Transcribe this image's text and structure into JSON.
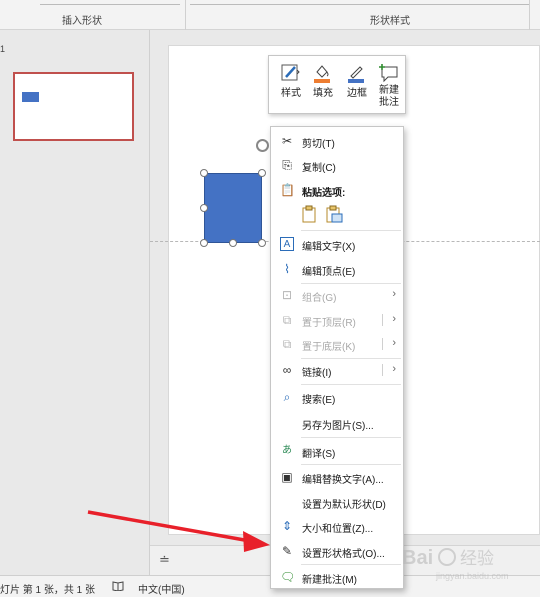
{
  "ribbon": {
    "group_insert_shapes": "插入形状",
    "group_shape_styles": "形状样式"
  },
  "thumbnails": {
    "slide_number": "1"
  },
  "mini_toolbar": {
    "items": [
      {
        "label": "样式",
        "icon": "style-brush-icon"
      },
      {
        "label": "填充",
        "icon": "fill-bucket-icon"
      },
      {
        "label": "边框",
        "icon": "outline-pen-icon"
      },
      {
        "label_line1": "新建",
        "label_line2": "批注",
        "icon": "new-comment-icon"
      }
    ]
  },
  "context_menu": {
    "cut": "剪切(T)",
    "copy": "复制(C)",
    "paste_options": "粘贴选项:",
    "edit_text": "编辑文字(X)",
    "edit_points": "编辑顶点(E)",
    "group": "组合(G)",
    "bring_to_front": "置于顶层(R)",
    "send_to_back": "置于底层(K)",
    "link": "链接(I)",
    "search": "搜索(E)",
    "save_as_picture": "另存为图片(S)...",
    "translate": "翻译(S)",
    "edit_alt_text": "编辑替换文字(A)...",
    "set_default_shape": "设置为默认形状(D)",
    "size_position": "大小和位置(Z)...",
    "format_shape": "设置形状格式(O)...",
    "new_comment": "新建批注(M)"
  },
  "status_bar": {
    "slide_info": "灯片 第 1 张，共 1 张",
    "language": "中文(中国)"
  },
  "watermark": {
    "text": "Bai 经验",
    "sub": "jingyan.baidu.com"
  },
  "colors": {
    "accent_red": "#e8202a",
    "shape_blue": "#4472c4",
    "thumb_border": "#c0504d"
  }
}
